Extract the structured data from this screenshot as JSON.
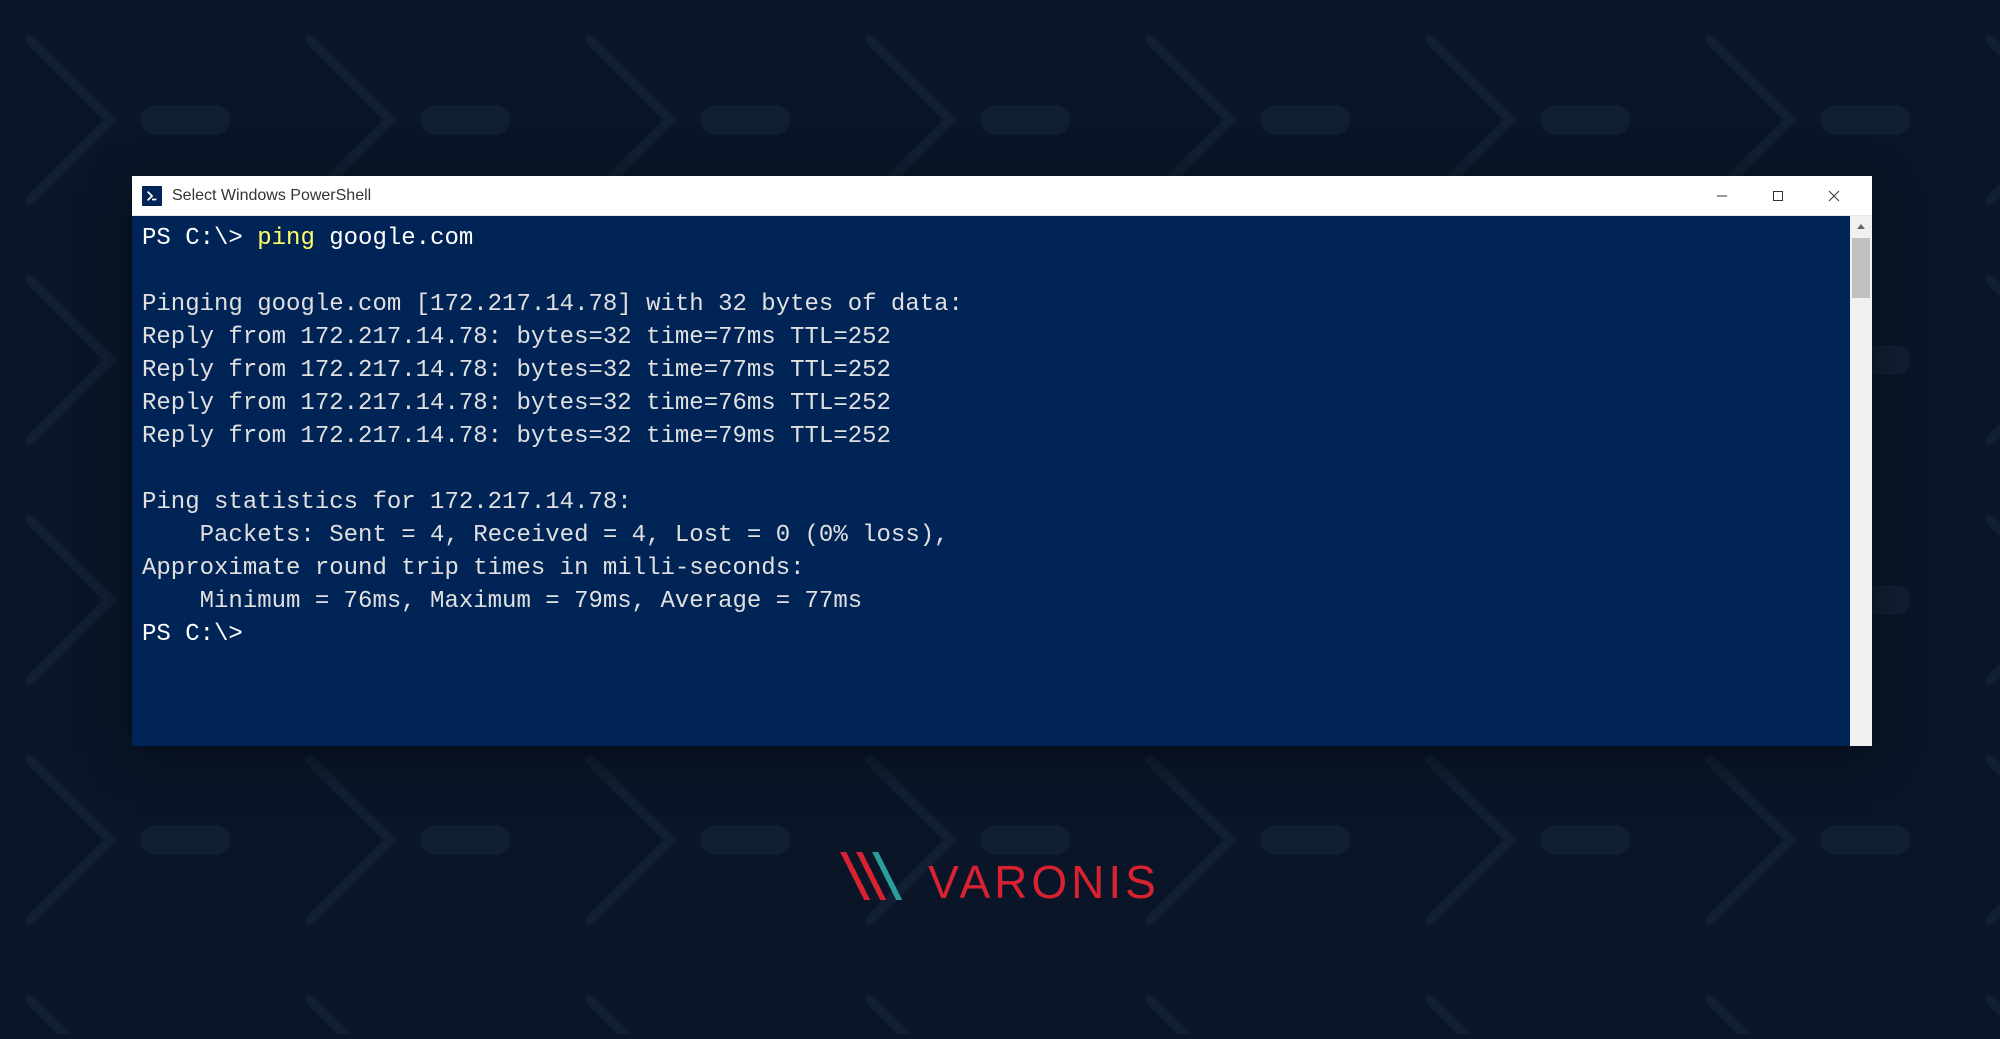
{
  "window": {
    "title": "Select Windows PowerShell",
    "icon_label": "powershell-icon"
  },
  "terminal": {
    "prompt1": "PS C:\\>",
    "command": "ping",
    "command_arg": "google.com",
    "output_lines": [
      "",
      "Pinging google.com [172.217.14.78] with 32 bytes of data:",
      "Reply from 172.217.14.78: bytes=32 time=77ms TTL=252",
      "Reply from 172.217.14.78: bytes=32 time=77ms TTL=252",
      "Reply from 172.217.14.78: bytes=32 time=76ms TTL=252",
      "Reply from 172.217.14.78: bytes=32 time=79ms TTL=252",
      "",
      "Ping statistics for 172.217.14.78:",
      "    Packets: Sent = 4, Received = 4, Lost = 0 (0% loss),",
      "Approximate round trip times in milli-seconds:",
      "    Minimum = 76ms, Maximum = 79ms, Average = 77ms"
    ],
    "prompt2": "PS C:\\>"
  },
  "branding": {
    "name": "VARONIS"
  },
  "colors": {
    "terminal_bg": "#012456",
    "terminal_fg": "#cccccc",
    "command_highlight": "#ffff66",
    "brand_red": "#d92231",
    "brand_teal": "#2b9b9b"
  }
}
